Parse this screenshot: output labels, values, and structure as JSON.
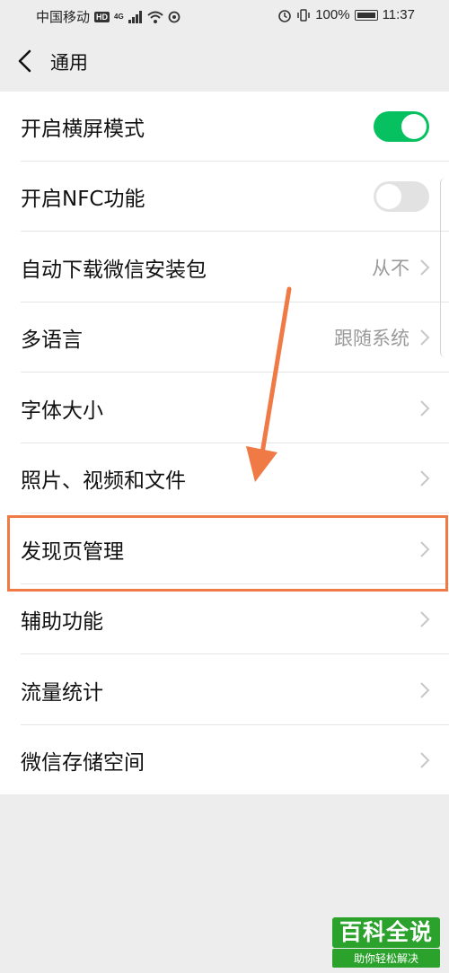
{
  "status_bar": {
    "carrier": "中国移动",
    "network_hd": "HD",
    "network_4g": "4G",
    "battery_percent": "100%",
    "time": "11:37"
  },
  "nav": {
    "back_icon": "chevron-left-icon",
    "title": "通用"
  },
  "settings": {
    "rows": [
      {
        "label": "开启横屏模式",
        "control": "toggle",
        "toggle_on": true
      },
      {
        "label": "开启NFC功能",
        "control": "toggle",
        "toggle_on": false
      },
      {
        "label": "自动下载微信安装包",
        "value": "从不"
      },
      {
        "label": "多语言",
        "value": "跟随系统"
      },
      {
        "label": "字体大小"
      },
      {
        "label": "照片、视频和文件"
      },
      {
        "label": "发现页管理",
        "highlighted": true
      },
      {
        "label": "辅助功能"
      },
      {
        "label": "流量统计"
      },
      {
        "label": "微信存储空间"
      }
    ]
  },
  "colors": {
    "accent_green": "#07c160",
    "annotation_orange": "#f07a45",
    "background": "#ededed"
  },
  "watermark": {
    "title": "百科全说",
    "subtitle": "助你轻松解决"
  }
}
